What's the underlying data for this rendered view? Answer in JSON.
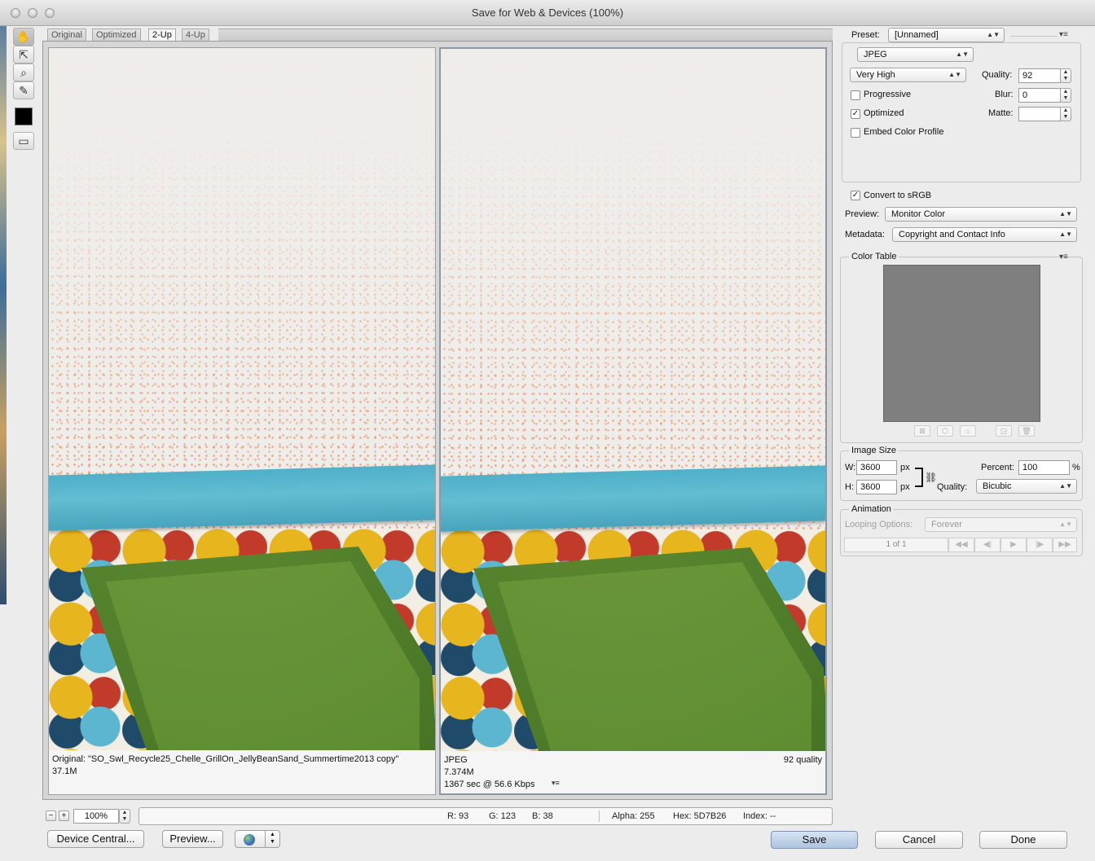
{
  "window": {
    "title": "Save for Web & Devices (100%)"
  },
  "toolbar": {
    "tools": [
      "hand-icon",
      "slice-select-icon",
      "zoom-icon",
      "eyedropper-icon"
    ],
    "eyedropper_color": "#000000"
  },
  "tabs": [
    "Original",
    "Optimized",
    "2-Up",
    "4-Up"
  ],
  "active_tab": "2-Up",
  "left_pane": {
    "caption_line1": "Original: \"SO_Swl_Recycle25_Chelle_GrillOn_JellyBeanSand_Summertime2013 copy\"",
    "caption_line2": "37.1M"
  },
  "right_pane": {
    "format": "JPEG",
    "size": "7.374M",
    "download": "1367 sec @ 56.6 Kbps",
    "quality_note": "92 quality",
    "menu_glyph": "▾≡"
  },
  "settings": {
    "preset_label": "Preset:",
    "preset_value": "[Unnamed]",
    "format_value": "JPEG",
    "quality_level": "Very High",
    "quality_label": "Quality:",
    "quality_value": "92",
    "progressive_label": "Progressive",
    "progressive_checked": false,
    "blur_label": "Blur:",
    "blur_value": "0",
    "optimized_label": "Optimized",
    "optimized_checked": true,
    "matte_label": "Matte:",
    "matte_value": "",
    "embed_label": "Embed Color Profile",
    "embed_checked": false,
    "srgb_label": "Convert to sRGB",
    "srgb_checked": true,
    "preview_label": "Preview:",
    "preview_value": "Monitor Color",
    "metadata_label": "Metadata:",
    "metadata_value": "Copyright and Contact Info",
    "menu_glyph": "▾≡"
  },
  "color_table": {
    "title": "Color Table",
    "swatch_color": "#7f7f7f"
  },
  "image_size": {
    "title": "Image Size",
    "w_label": "W:",
    "w_value": "3600",
    "h_label": "H:",
    "h_value": "3600",
    "unit": "px",
    "percent_label": "Percent:",
    "percent_value": "100",
    "percent_unit": "%",
    "quality_label": "Quality:",
    "quality_value": "Bicubic"
  },
  "animation": {
    "title": "Animation",
    "looping_label": "Looping Options:",
    "looping_value": "Forever",
    "frame_counter": "1 of 1"
  },
  "bottom": {
    "zoom_value": "100%",
    "zoom_minus": "−",
    "zoom_plus": "+",
    "r": "R: 93",
    "g": "G: 123",
    "b": "B: 38",
    "alpha": "Alpha: 255",
    "hex": "Hex: 5D7B26",
    "index": "Index: --",
    "device_central_label": "Device Central...",
    "preview_label": "Preview...",
    "save_label": "Save",
    "cancel_label": "Cancel",
    "done_label": "Done"
  }
}
